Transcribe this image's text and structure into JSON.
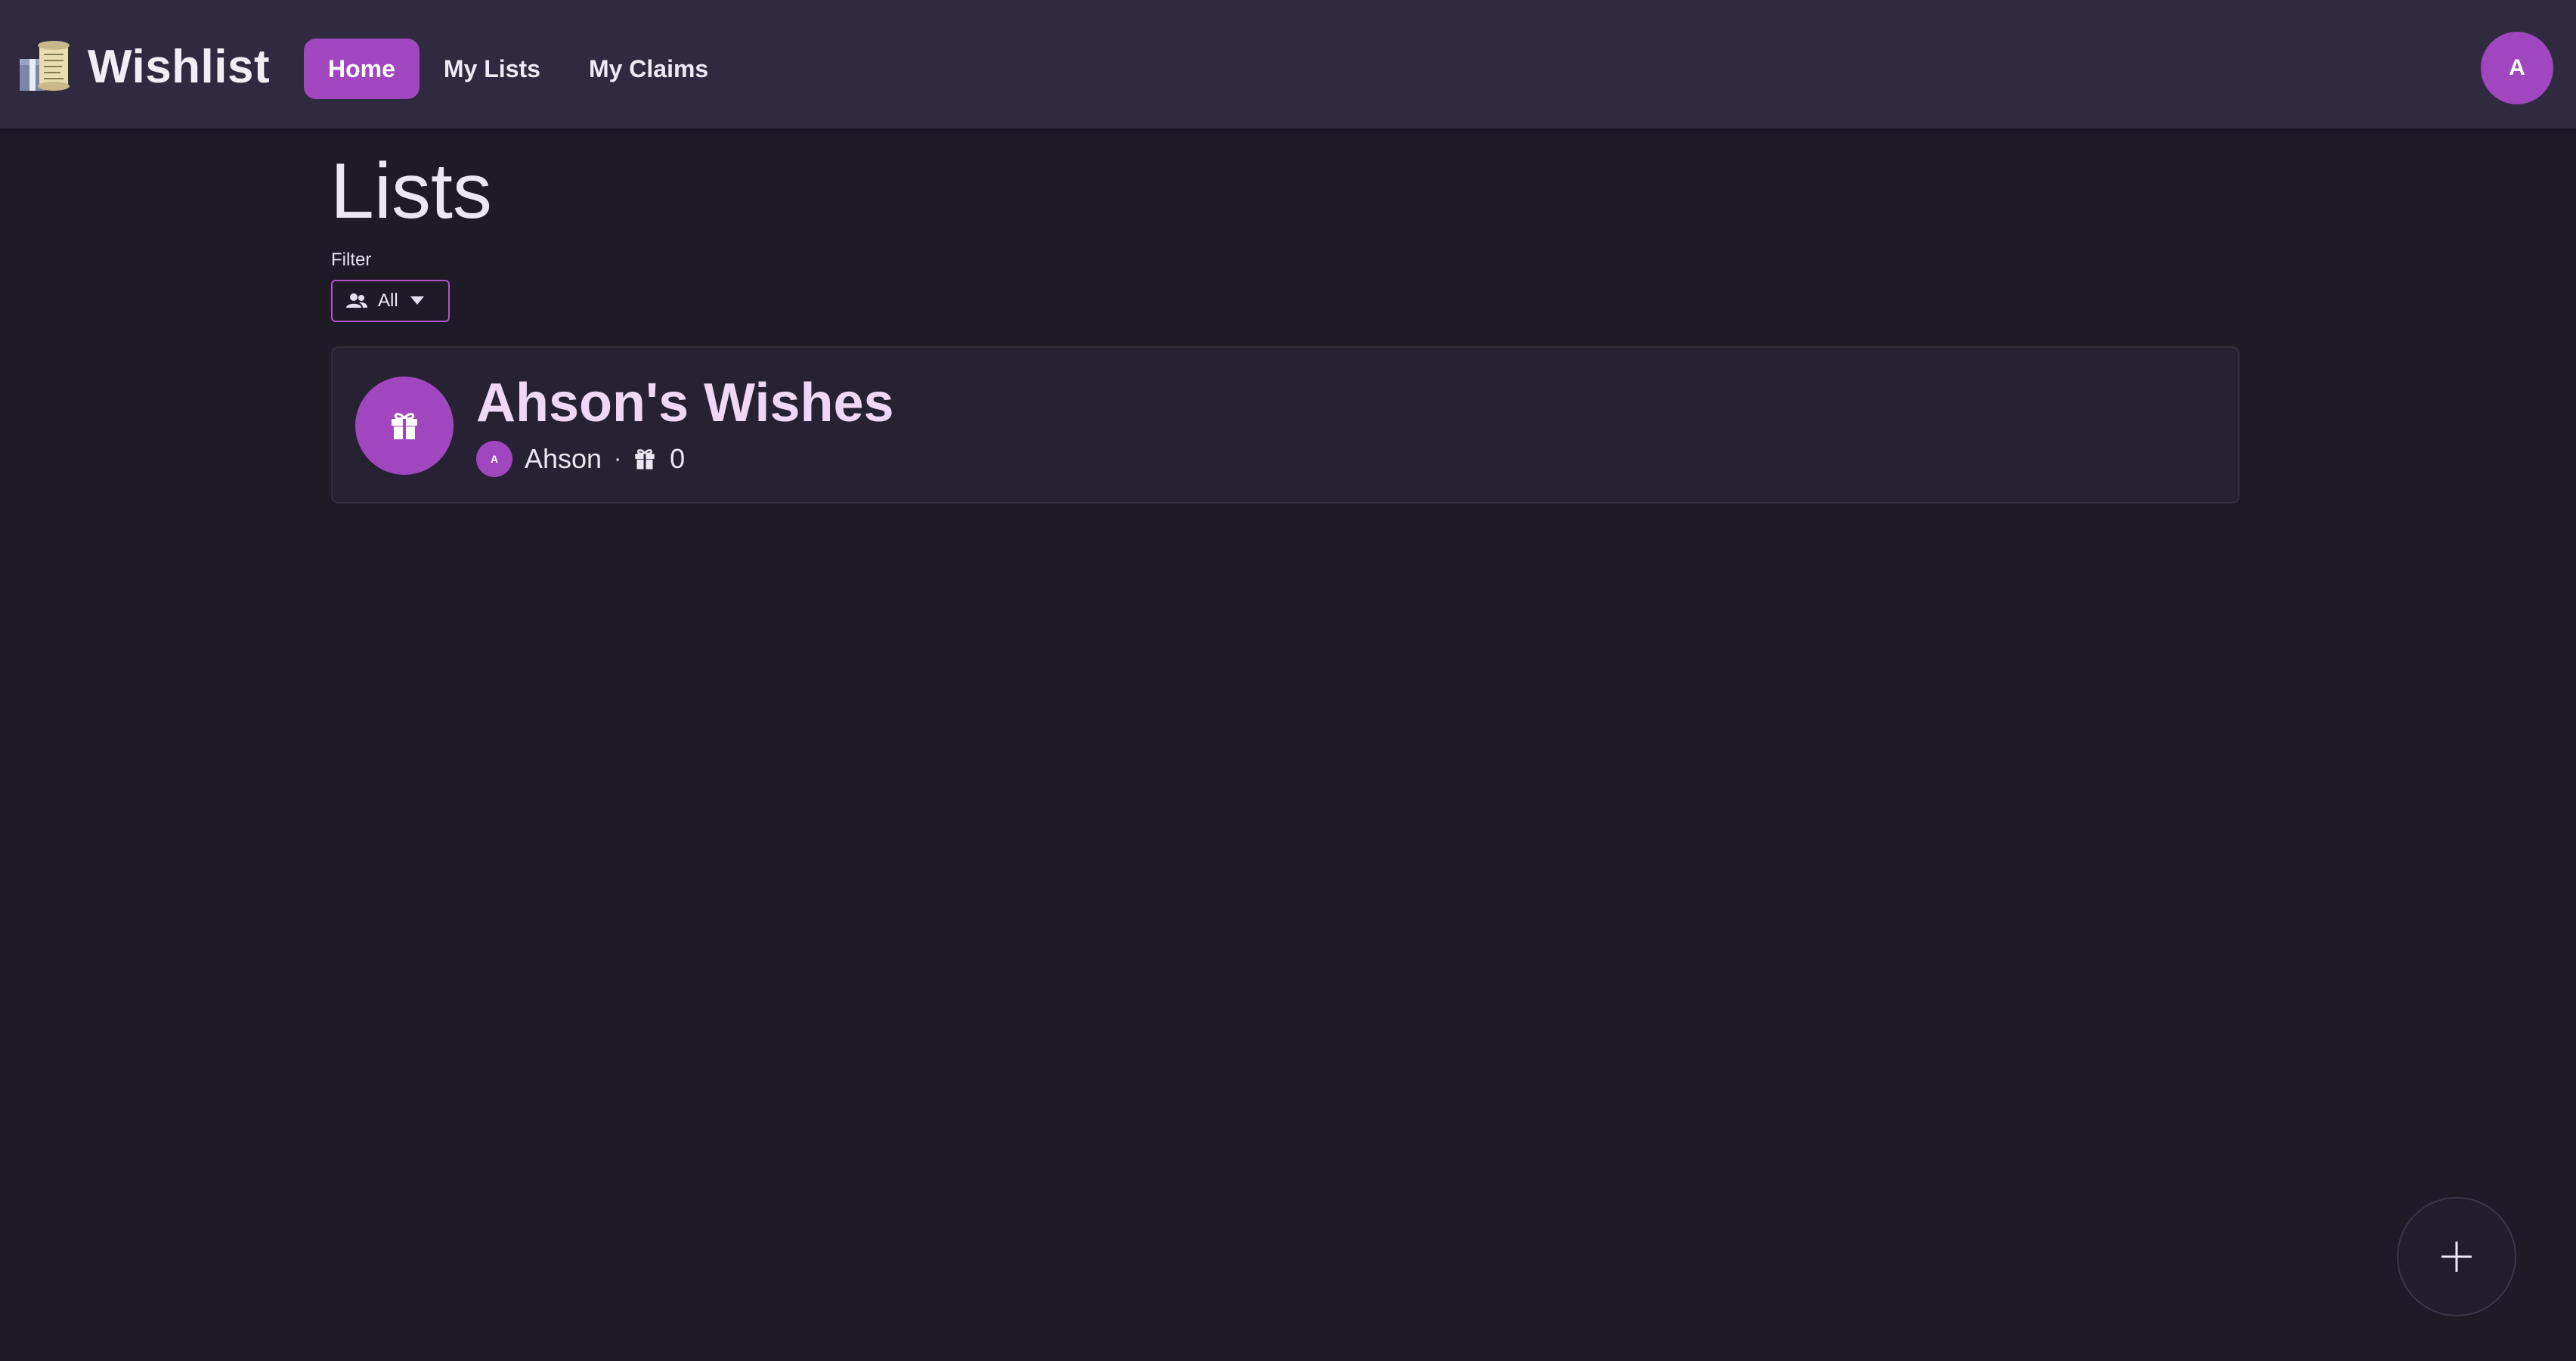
{
  "app": {
    "title": "Wishlist",
    "logo_icon": "scroll-and-gift-logo"
  },
  "nav": {
    "items": [
      {
        "label": "Home",
        "active": true
      },
      {
        "label": "My Lists",
        "active": false
      },
      {
        "label": "My Claims",
        "active": false
      }
    ]
  },
  "user": {
    "avatar_initial": "A"
  },
  "main": {
    "title": "Lists",
    "filter": {
      "label": "Filter",
      "value": "All",
      "icon": "people-icon"
    },
    "lists": [
      {
        "title": "Ahson's Wishes",
        "owner_name": "Ahson",
        "owner_initial": "A",
        "separator": "·",
        "item_count": "0",
        "icon": "gift-icon"
      }
    ]
  },
  "fab": {
    "icon": "plus-icon"
  },
  "colors": {
    "background": "#1e1b27",
    "header": "#302a40",
    "accent": "#a046bf",
    "card": "#272233",
    "card_title": "#efd8f5"
  }
}
